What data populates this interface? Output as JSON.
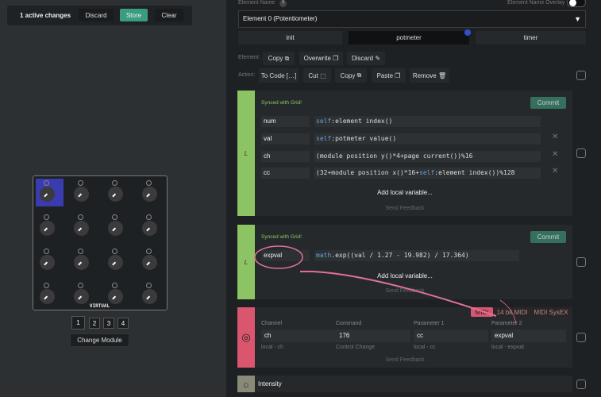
{
  "changes": {
    "text": "1 active changes",
    "discard": "Discard",
    "store": "Store",
    "clear": "Clear"
  },
  "module": {
    "label": "VIRTUAL",
    "pages": [
      "1",
      "2",
      "3",
      "4"
    ],
    "active_page": "1",
    "change_module": "Change Module",
    "selected_knob": 0
  },
  "element": {
    "name_label": "Element Name",
    "help": "?",
    "overlay_label": "Element Name Overlay",
    "selected": "Element 0 (Potentiometer)"
  },
  "tabs": [
    "init",
    "potmeter",
    "timer"
  ],
  "active_tab": "potmeter",
  "element_actions": {
    "label": "Element:",
    "copy": "Copy",
    "overwrite": "Overwrite",
    "discard": "Discard"
  },
  "actions": {
    "label": "Action:",
    "to_code": "To Code",
    "cut": "Cut",
    "copy": "Copy",
    "paste": "Paste",
    "remove": "Remove"
  },
  "locals1": {
    "bar": "L",
    "synced": "Synced with Grid!",
    "commit": "Commit",
    "vars": [
      {
        "name": "num",
        "kw": "self",
        "expr": ":element index()"
      },
      {
        "name": "val",
        "kw": "self",
        "expr": ":potmeter value()"
      },
      {
        "name": "ch",
        "kw": "",
        "expr": "(module position y()*4+page current())%16"
      },
      {
        "name": "cc",
        "kw": "",
        "expr": "(32+module position x()*16+",
        "kw2": "self",
        "expr2": ":element index())%128"
      }
    ],
    "add": "Add local variable...",
    "feedback": "Send Feedback"
  },
  "locals2": {
    "bar": "L",
    "synced": "Synced with Grid!",
    "commit": "Commit",
    "var": {
      "name": "expval",
      "kw": "math",
      "expr": ".exp((val / 1.27 - 19.982) / 17.364)"
    },
    "add": "Add local variable...",
    "feedback": "Send Feedback"
  },
  "midi": {
    "tabs": [
      "MIDI",
      "14 bit MIDI",
      "MIDI SysEX"
    ],
    "fields": [
      {
        "label": "Channel",
        "value": "ch",
        "sub": "local - ch"
      },
      {
        "label": "Command",
        "value": "176",
        "sub": "Control Change"
      },
      {
        "label": "Parameter 1",
        "value": "cc",
        "sub": "local - cc"
      },
      {
        "label": "Parameter 2",
        "value": "expval",
        "sub": "local - expval"
      }
    ],
    "feedback": "Send Feedback"
  },
  "intensity": {
    "label": "Intensity"
  },
  "colors": {
    "green": "#8cc463",
    "red": "#d9566e",
    "accent": "#3a9c80",
    "annotation": "#e0709a",
    "selected_knob": "#3b3bb0"
  }
}
